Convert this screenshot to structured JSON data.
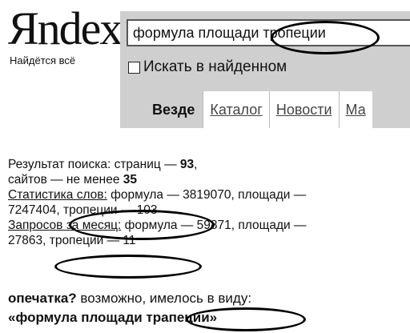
{
  "logo": {
    "text": "Яndex",
    "tagline": "Найдётся всё"
  },
  "search": {
    "query": "формула площади тропеции"
  },
  "options": {
    "search_in_found_label": "Искать в найденном"
  },
  "tabs": [
    {
      "label": "Везде",
      "active": true
    },
    {
      "label": "Каталог",
      "active": false
    },
    {
      "label": "Новости",
      "active": false
    },
    {
      "label": "Ма",
      "active": false
    }
  ],
  "results_stats": {
    "line1_prefix": "Результат поиска: страниц — ",
    "pages_count": "93",
    "line1_suffix": ",",
    "line2_prefix": "сайтов — не менее ",
    "sites_count": "35",
    "word_stats_link": "Статистика слов:",
    "word_stats_1": " формула — 3819070, площади —",
    "word_stats_2a": "7247404, ",
    "word_stats_2b": "тропеции — 103",
    "queries_link": "Запросов за месяц:",
    "queries_1": " формула — 59871, площади —",
    "queries_2a": "27863, ",
    "queries_2b": "тропеции — 11"
  },
  "spelling": {
    "typo_label": "опечатка?",
    "typo_text": " возможно, имелось в виду:",
    "suggest_open": "«формула площади ",
    "suggest_word": "трапеции",
    "suggest_close": "»"
  }
}
